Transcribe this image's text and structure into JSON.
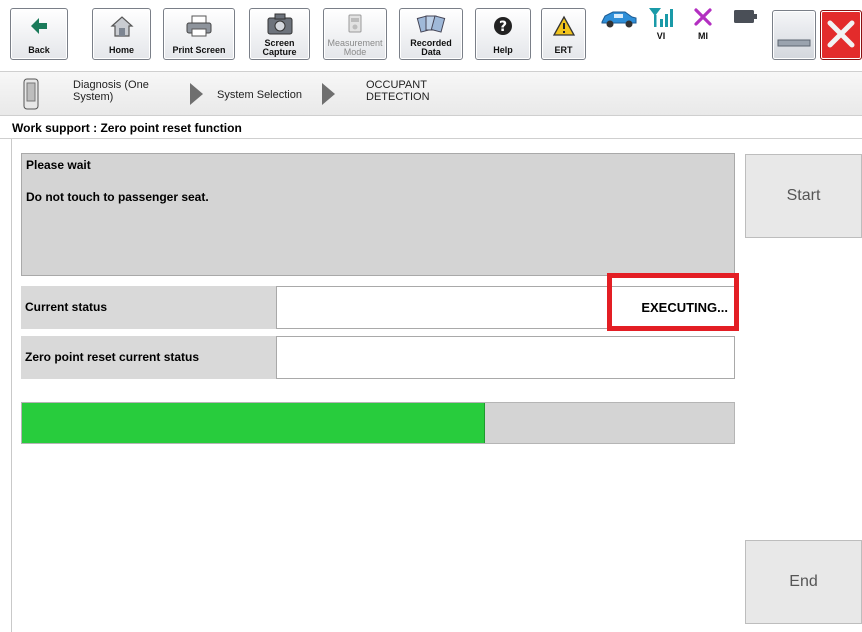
{
  "toolbar": {
    "buttons": [
      {
        "label": "Back",
        "icon": "back-arrow-icon"
      },
      {
        "label": "Home",
        "icon": "home-icon"
      },
      {
        "label": "Print Screen",
        "icon": "printer-icon"
      },
      {
        "label": "Screen\nCapture",
        "icon": "camera-icon"
      },
      {
        "label": "Measurement\nMode",
        "icon": "measurement-icon",
        "state": "disabled"
      },
      {
        "label": "Recorded\nData",
        "icon": "recorded-data-icon"
      },
      {
        "label": "Help",
        "icon": "help-icon"
      },
      {
        "label": "ERT",
        "icon": "warning-icon"
      }
    ],
    "indicators": [
      {
        "label": "",
        "icon": "vehicle-icon"
      },
      {
        "label": "VI",
        "icon": "signal-icon"
      },
      {
        "label": "MI",
        "icon": "x-icon"
      },
      {
        "label": "",
        "icon": "battery-icon"
      }
    ],
    "window_buttons": [
      {
        "icon": "minimize-icon"
      },
      {
        "icon": "close-icon"
      }
    ]
  },
  "breadcrumb": {
    "items": [
      {
        "label": "Diagnosis (One\nSystem)"
      },
      {
        "label": "System Selection"
      },
      {
        "label": "OCCUPANT\nDETECTION"
      }
    ]
  },
  "section_title": "Work support : Zero point reset function",
  "message": {
    "title": "Please wait",
    "body": "Do not touch to passenger seat."
  },
  "buttons": {
    "start": "Start",
    "end": "End"
  },
  "status_rows": [
    {
      "label": "Current status",
      "value": "EXECUTING..."
    },
    {
      "label": "Zero point reset current status",
      "value": ""
    }
  ],
  "progress": {
    "fraction": 0.65
  },
  "colors": {
    "progress_fill": "#28cc3d",
    "highlight": "#e31e24",
    "close_red": "#e32b2b"
  }
}
